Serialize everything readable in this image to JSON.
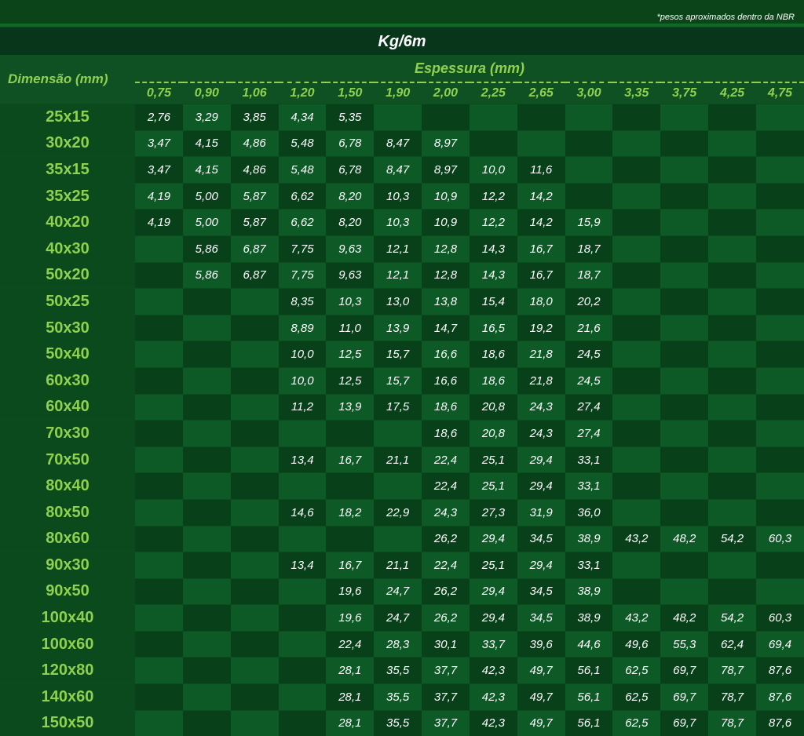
{
  "note": "*pesos aproximados dentro da NBR",
  "title": "Kg/6m",
  "dimension_header": "Dimensão (mm)",
  "thickness_header": "Espessura (mm)",
  "thicknesses": [
    "0,75",
    "0,90",
    "1,06",
    "1,20",
    "1,50",
    "1,90",
    "2,00",
    "2,25",
    "2,65",
    "3,00",
    "3,35",
    "3,75",
    "4,25",
    "4,75"
  ],
  "rows": [
    {
      "dim": "25x15",
      "values": [
        "2,76",
        "3,29",
        "3,85",
        "4,34",
        "5,35",
        "",
        "",
        "",
        "",
        "",
        "",
        "",
        "",
        ""
      ]
    },
    {
      "dim": "30x20",
      "values": [
        "3,47",
        "4,15",
        "4,86",
        "5,48",
        "6,78",
        "8,47",
        "8,97",
        "",
        "",
        "",
        "",
        "",
        "",
        ""
      ]
    },
    {
      "dim": "35x15",
      "values": [
        "3,47",
        "4,15",
        "4,86",
        "5,48",
        "6,78",
        "8,47",
        "8,97",
        "10,0",
        "11,6",
        "",
        "",
        "",
        "",
        ""
      ]
    },
    {
      "dim": "35x25",
      "values": [
        "4,19",
        "5,00",
        "5,87",
        "6,62",
        "8,20",
        "10,3",
        "10,9",
        "12,2",
        "14,2",
        "",
        "",
        "",
        "",
        ""
      ]
    },
    {
      "dim": "40x20",
      "values": [
        "4,19",
        "5,00",
        "5,87",
        "6,62",
        "8,20",
        "10,3",
        "10,9",
        "12,2",
        "14,2",
        "15,9",
        "",
        "",
        "",
        ""
      ]
    },
    {
      "dim": "40x30",
      "values": [
        "",
        "5,86",
        "6,87",
        "7,75",
        "9,63",
        "12,1",
        "12,8",
        "14,3",
        "16,7",
        "18,7",
        "",
        "",
        "",
        ""
      ]
    },
    {
      "dim": "50x20",
      "values": [
        "",
        "5,86",
        "6,87",
        "7,75",
        "9,63",
        "12,1",
        "12,8",
        "14,3",
        "16,7",
        "18,7",
        "",
        "",
        "",
        ""
      ]
    },
    {
      "dim": "50x25",
      "values": [
        "",
        "",
        "",
        "8,35",
        "10,3",
        "13,0",
        "13,8",
        "15,4",
        "18,0",
        "20,2",
        "",
        "",
        "",
        ""
      ]
    },
    {
      "dim": "50x30",
      "values": [
        "",
        "",
        "",
        "8,89",
        "11,0",
        "13,9",
        "14,7",
        "16,5",
        "19,2",
        "21,6",
        "",
        "",
        "",
        ""
      ]
    },
    {
      "dim": "50x40",
      "values": [
        "",
        "",
        "",
        "10,0",
        "12,5",
        "15,7",
        "16,6",
        "18,6",
        "21,8",
        "24,5",
        "",
        "",
        "",
        ""
      ]
    },
    {
      "dim": "60x30",
      "values": [
        "",
        "",
        "",
        "10,0",
        "12,5",
        "15,7",
        "16,6",
        "18,6",
        "21,8",
        "24,5",
        "",
        "",
        "",
        ""
      ]
    },
    {
      "dim": "60x40",
      "values": [
        "",
        "",
        "",
        "11,2",
        "13,9",
        "17,5",
        "18,6",
        "20,8",
        "24,3",
        "27,4",
        "",
        "",
        "",
        ""
      ]
    },
    {
      "dim": "70x30",
      "values": [
        "",
        "",
        "",
        "",
        "",
        "",
        "18,6",
        "20,8",
        "24,3",
        "27,4",
        "",
        "",
        "",
        ""
      ]
    },
    {
      "dim": "70x50",
      "values": [
        "",
        "",
        "",
        "13,4",
        "16,7",
        "21,1",
        "22,4",
        "25,1",
        "29,4",
        "33,1",
        "",
        "",
        "",
        ""
      ]
    },
    {
      "dim": "80x40",
      "values": [
        "",
        "",
        "",
        "",
        "",
        "",
        "22,4",
        "25,1",
        "29,4",
        "33,1",
        "",
        "",
        "",
        ""
      ]
    },
    {
      "dim": "80x50",
      "values": [
        "",
        "",
        "",
        "14,6",
        "18,2",
        "22,9",
        "24,3",
        "27,3",
        "31,9",
        "36,0",
        "",
        "",
        "",
        ""
      ]
    },
    {
      "dim": "80x60",
      "values": [
        "",
        "",
        "",
        "",
        "",
        "",
        "26,2",
        "29,4",
        "34,5",
        "38,9",
        "43,2",
        "48,2",
        "54,2",
        "60,3"
      ]
    },
    {
      "dim": "90x30",
      "values": [
        "",
        "",
        "",
        "13,4",
        "16,7",
        "21,1",
        "22,4",
        "25,1",
        "29,4",
        "33,1",
        "",
        "",
        "",
        ""
      ]
    },
    {
      "dim": "90x50",
      "values": [
        "",
        "",
        "",
        "",
        "19,6",
        "24,7",
        "26,2",
        "29,4",
        "34,5",
        "38,9",
        "",
        "",
        "",
        ""
      ]
    },
    {
      "dim": "100x40",
      "values": [
        "",
        "",
        "",
        "",
        "19,6",
        "24,7",
        "26,2",
        "29,4",
        "34,5",
        "38,9",
        "43,2",
        "48,2",
        "54,2",
        "60,3"
      ]
    },
    {
      "dim": "100x60",
      "values": [
        "",
        "",
        "",
        "",
        "22,4",
        "28,3",
        "30,1",
        "33,7",
        "39,6",
        "44,6",
        "49,6",
        "55,3",
        "62,4",
        "69,4"
      ]
    },
    {
      "dim": "120x80",
      "values": [
        "",
        "",
        "",
        "",
        "28,1",
        "35,5",
        "37,7",
        "42,3",
        "49,7",
        "56,1",
        "62,5",
        "69,7",
        "78,7",
        "87,6"
      ]
    },
    {
      "dim": "140x60",
      "values": [
        "",
        "",
        "",
        "",
        "28,1",
        "35,5",
        "37,7",
        "42,3",
        "49,7",
        "56,1",
        "62,5",
        "69,7",
        "78,7",
        "87,6"
      ]
    },
    {
      "dim": "150x50",
      "values": [
        "",
        "",
        "",
        "",
        "28,1",
        "35,5",
        "37,7",
        "42,3",
        "49,7",
        "56,1",
        "62,5",
        "69,7",
        "78,7",
        "87,6"
      ]
    }
  ]
}
